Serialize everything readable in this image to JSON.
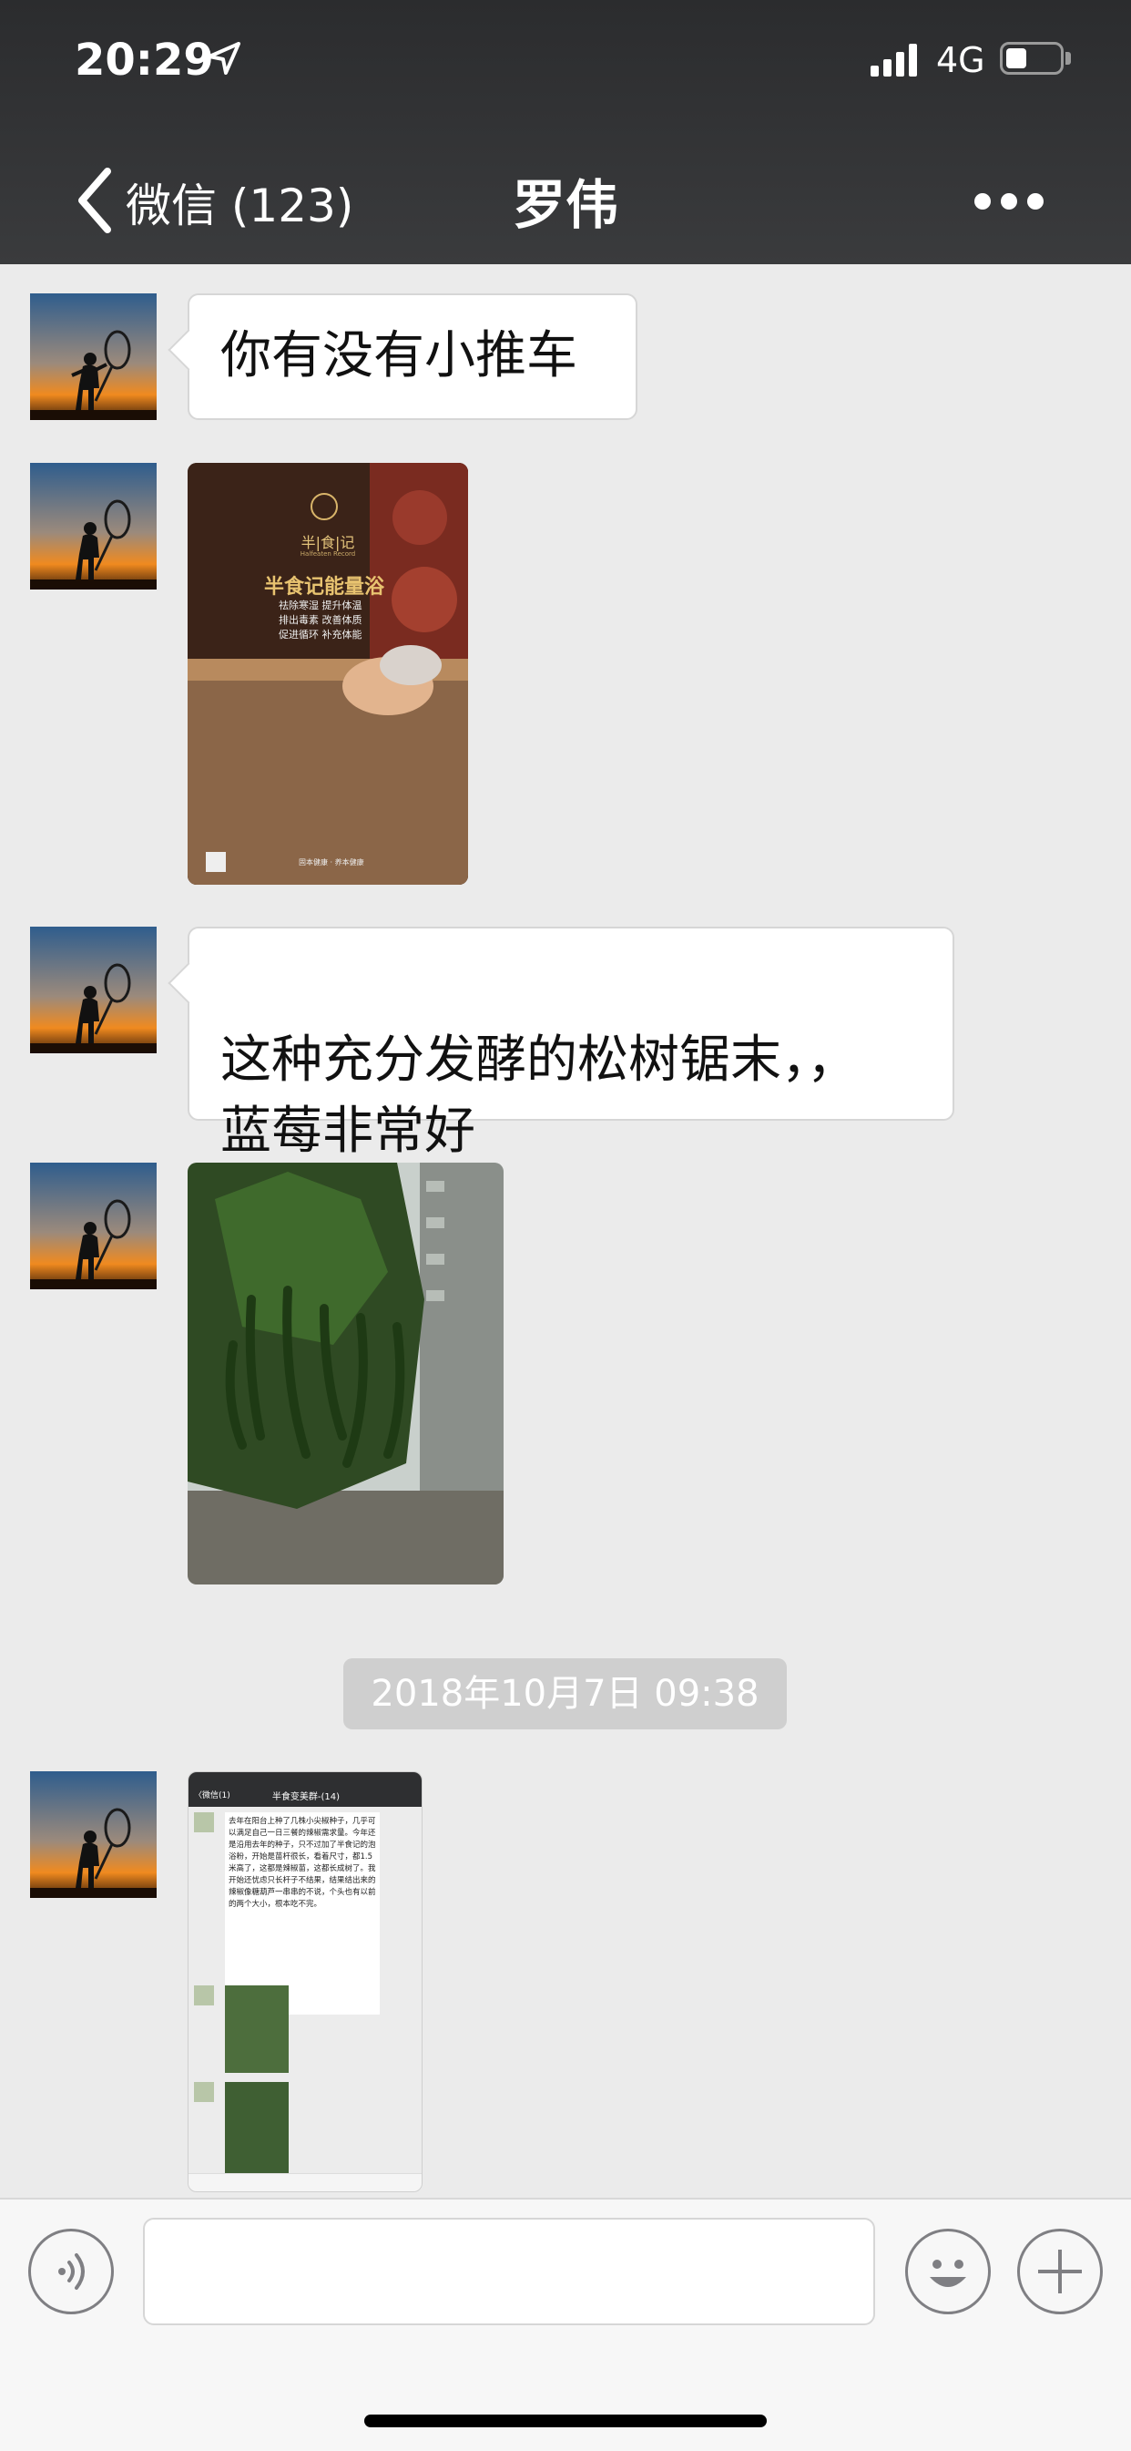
{
  "status_bar": {
    "time": "20:29",
    "network": "4G"
  },
  "nav": {
    "back_label": "微信 (123)",
    "title": "罗伟"
  },
  "messages": [
    {
      "type": "text",
      "text": "你有没有小推车"
    },
    {
      "type": "image",
      "description_icon": "sand-bath-poster-icon",
      "poster": {
        "brand": "半|食|记",
        "brand_sub": "Halfeaten Record",
        "headline": "半食记能量浴",
        "line1": "祛除寒湿  提升体温",
        "line2": "排出毒素  改善体质",
        "line3": "促进循环  补充体能",
        "footer": "固本健康 · 养本健康"
      }
    },
    {
      "type": "text",
      "text": "这种充分发酵的松树锯末，，\n蓝莓非常好"
    },
    {
      "type": "image",
      "description_icon": "chili-plant-photo-icon"
    },
    {
      "type": "timestamp",
      "text": "2018年10月7日 09:38"
    },
    {
      "type": "image",
      "description_icon": "chat-screenshot-icon",
      "screenshot": {
        "back": "〈微信(1)",
        "title": "半食变美群-(14)",
        "message": "去年在阳台上种了几株小尖椒种子，几乎可以满足自己一日三餐的辣椒需求量。今年还是沿用去年的种子，只不过加了半食记的泡浴粉，开始是苗杆很长，看着尺寸，都1.5米高了，这都是辣椒苗，这都长成树了。我开始还忧虑只长杆子不结果，结果结出来的辣椒像糖葫芦一串串的不说，个头也有以前的两个大小，根本吃不完。"
      }
    }
  ],
  "colors": {
    "header_bg": "#2f3032",
    "chat_bg": "#ebebeb",
    "bubble_bg": "#ffffff",
    "timestamp_bg": "#cfcfcf"
  }
}
